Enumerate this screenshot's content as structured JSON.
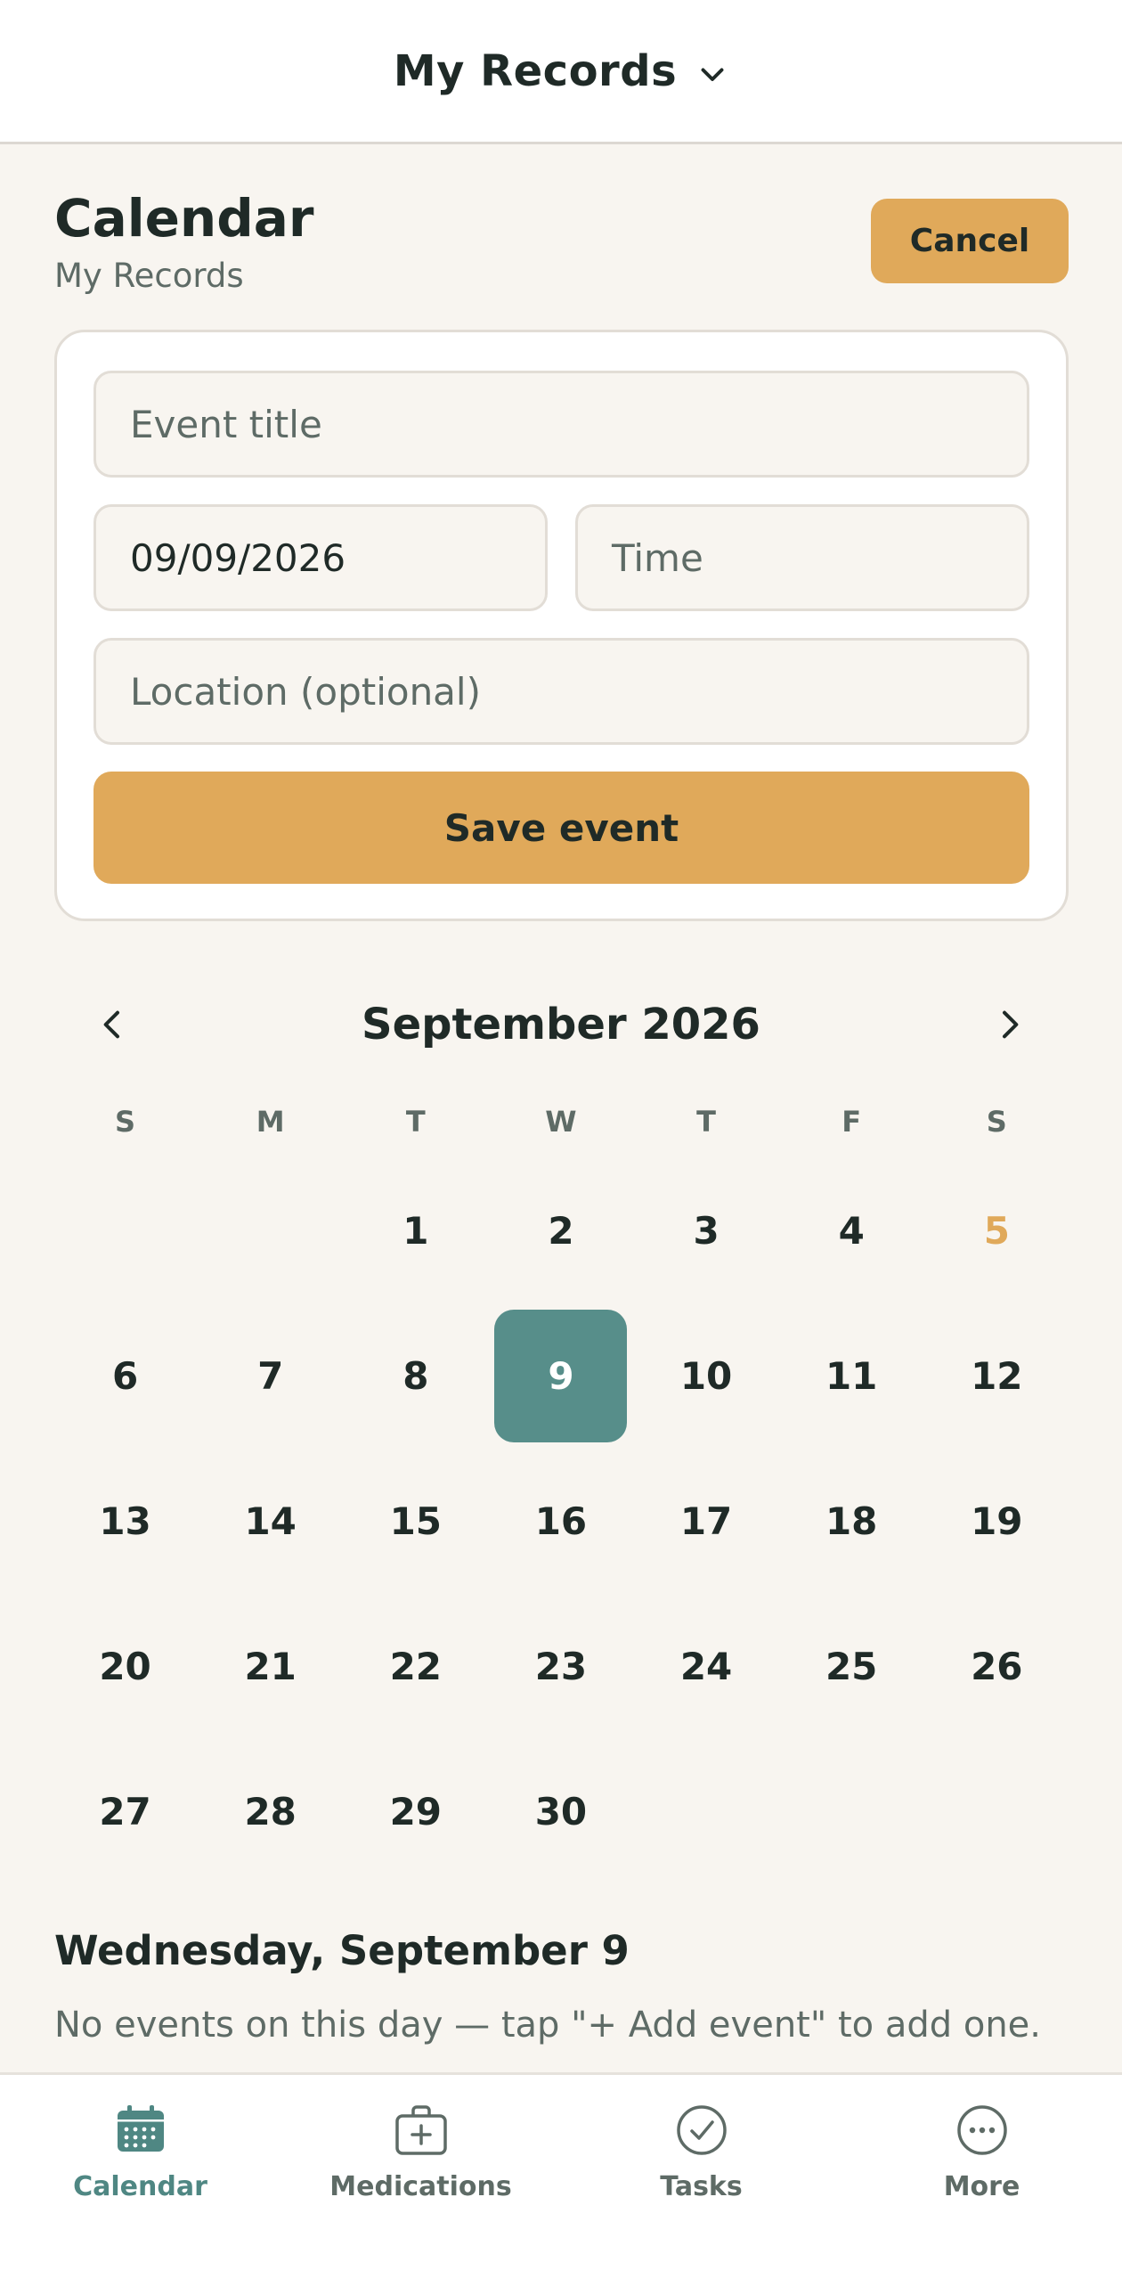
{
  "topbar": {
    "title": "My Records"
  },
  "header": {
    "title": "Calendar",
    "subtitle": "My Records",
    "cancel_label": "Cancel"
  },
  "form": {
    "title_placeholder": "Event title",
    "date_value": "09/09/2026",
    "time_placeholder": "Time",
    "location_placeholder": "Location (optional)",
    "save_label": "Save event"
  },
  "calendar": {
    "month_label": "September 2026",
    "weekdays": [
      "S",
      "M",
      "T",
      "W",
      "T",
      "F",
      "S"
    ],
    "weeks": [
      [
        "",
        "",
        "1",
        "2",
        "3",
        "4",
        "5"
      ],
      [
        "6",
        "7",
        "8",
        "9",
        "10",
        "11",
        "12"
      ],
      [
        "13",
        "14",
        "15",
        "16",
        "17",
        "18",
        "19"
      ],
      [
        "20",
        "21",
        "22",
        "23",
        "24",
        "25",
        "26"
      ],
      [
        "27",
        "28",
        "29",
        "30",
        "",
        "",
        ""
      ]
    ],
    "selected_day": "9",
    "today_day": "5"
  },
  "day_view": {
    "heading": "Wednesday, September 9",
    "empty_text": "No events on this day — tap \"+ Add event\" to add one."
  },
  "bottom_nav": {
    "items": [
      {
        "label": "Calendar",
        "icon": "calendar-icon",
        "active": true
      },
      {
        "label": "Medications",
        "icon": "medical-kit-icon",
        "active": false
      },
      {
        "label": "Tasks",
        "icon": "check-circle-icon",
        "active": false
      },
      {
        "label": "More",
        "icon": "more-icon",
        "active": false
      }
    ]
  },
  "colors": {
    "accent": "#e0a95a",
    "selected": "#578e8a",
    "active_nav": "#4f8783",
    "background": "#f8f5f0"
  }
}
